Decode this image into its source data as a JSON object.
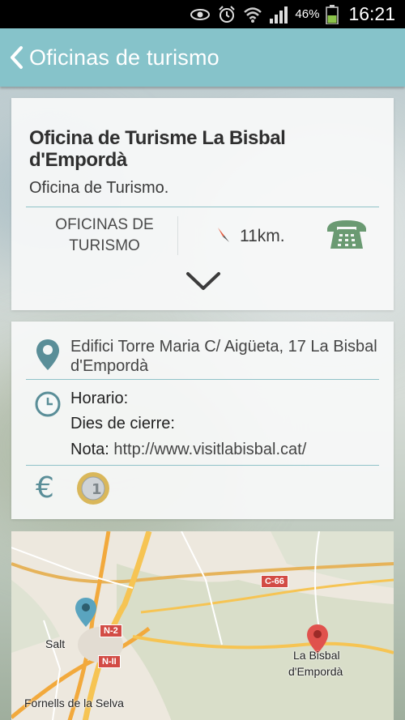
{
  "status_bar": {
    "battery_percent": "46%",
    "time": "16:21",
    "icons": [
      "eye-icon",
      "alarm-icon",
      "wifi-icon",
      "signal-icon",
      "battery-icon"
    ]
  },
  "app_bar": {
    "title": "Oficinas de turismo",
    "back_icon": "chevron-left-icon"
  },
  "summary_card": {
    "name": "Oficina de Turisme La Bisbal d'Empordà",
    "type": "Oficina de Turismo.",
    "category": "OFICINAS DE TURISMO",
    "distance": "11km.",
    "phone_icon": "phone-icon",
    "expand_icon": "chevron-down-icon"
  },
  "details_card": {
    "address": "Edifici Torre Maria C/ Aigüeta, 17 La Bisbal d'Empordà",
    "schedule_label": "Horario:",
    "closing_days_label": "Dies de cierre:",
    "note_label": "Nota:",
    "note_value": "http://www.visitlabisbal.cat/",
    "price_icons": [
      "euro-icon",
      "coin-icon"
    ],
    "coin_text": "1"
  },
  "map": {
    "place_labels": [
      "Salt",
      "La Bisbal",
      "d'Empordà",
      "Fornells de la Selva"
    ],
    "road_labels": [
      "N-2",
      "N-II",
      "C-66"
    ]
  },
  "colors": {
    "accent": "#86c3ca",
    "phone": "#6a9a72",
    "pin_blue": "#5aa4bf",
    "pin_red": "#e0524d"
  }
}
